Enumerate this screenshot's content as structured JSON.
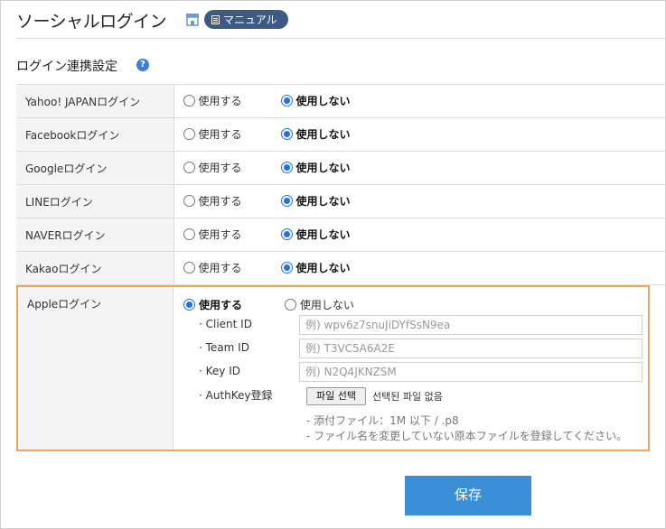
{
  "page": {
    "title": "ソーシャルログイン",
    "manual_label": "マニュアル"
  },
  "section": {
    "title": "ログイン連携設定",
    "help": "?"
  },
  "option_labels": {
    "use": "使用する",
    "not_use": "使用しない"
  },
  "providers": [
    {
      "label": "Yahoo! JAPANログイン",
      "selected": "not_use"
    },
    {
      "label": "Facebookログイン",
      "selected": "not_use"
    },
    {
      "label": "Googleログイン",
      "selected": "not_use"
    },
    {
      "label": "LINEログイン",
      "selected": "not_use"
    },
    {
      "label": "NAVERログイン",
      "selected": "not_use"
    },
    {
      "label": "Kakaoログイン",
      "selected": "not_use"
    }
  ],
  "apple": {
    "label": "Appleログイン",
    "selected": "use",
    "client_id_label": "· Client ID",
    "client_id_placeholder": "例) wpv6z7snuJiDYfSsN9ea",
    "team_id_label": "· Team ID",
    "team_id_placeholder": "例) T3VC5A6A2E",
    "key_id_label": "· Key ID",
    "key_id_placeholder": "例) N2Q4JKNZSM",
    "authkey_label": "· AuthKey登録",
    "file_button": "파일 선택",
    "file_status": "선택된 파일 없음",
    "note1": "- 添付ファイル：1M 以下 / .p8",
    "note2": "- ファイル名を変更していない原本ファイルを登録してください。"
  },
  "save_label": "保存",
  "colors": {
    "accent": "#1a73e8",
    "save": "#3a8fd6",
    "highlight": "#f0a35a",
    "pill": "#3d5a85"
  }
}
